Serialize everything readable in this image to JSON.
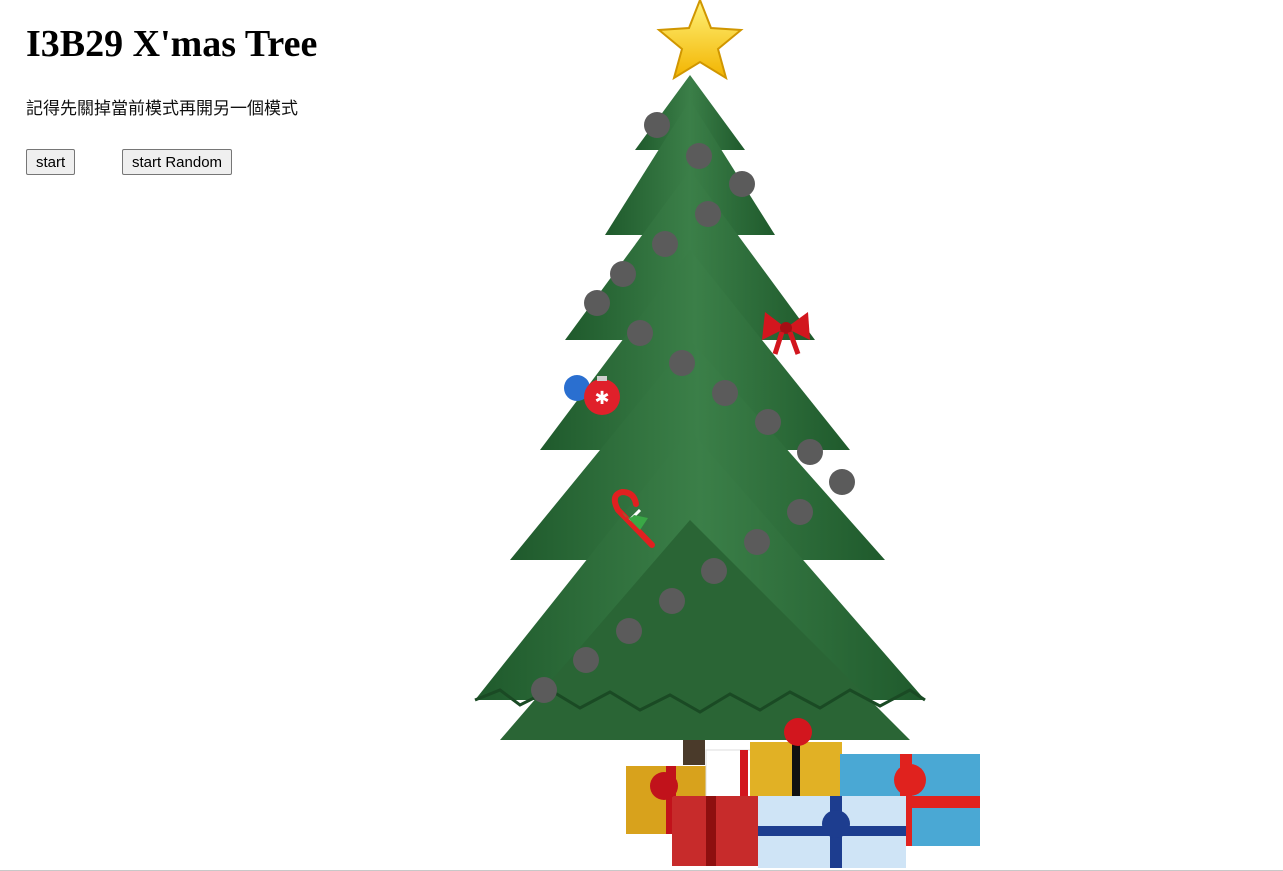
{
  "header": {
    "title": "I3B29 X'mas Tree",
    "note": "記得先關掉當前模式再開另一個模式"
  },
  "controls": {
    "start_label": "start",
    "random_label": "start Random"
  },
  "tree": {
    "light_count": 22,
    "light_color": "#5b5b5b",
    "ornaments": [
      "star-topper-icon",
      "bow-ornament-icon",
      "bauble-ornaments-icon",
      "candy-cane-ornament-icon"
    ],
    "gifts": [
      "gift-box-icon"
    ]
  },
  "colors": {
    "tree_green": "#2f6e3c",
    "star_gold": "#ffd21f",
    "ribbon_red": "#d2161e"
  }
}
